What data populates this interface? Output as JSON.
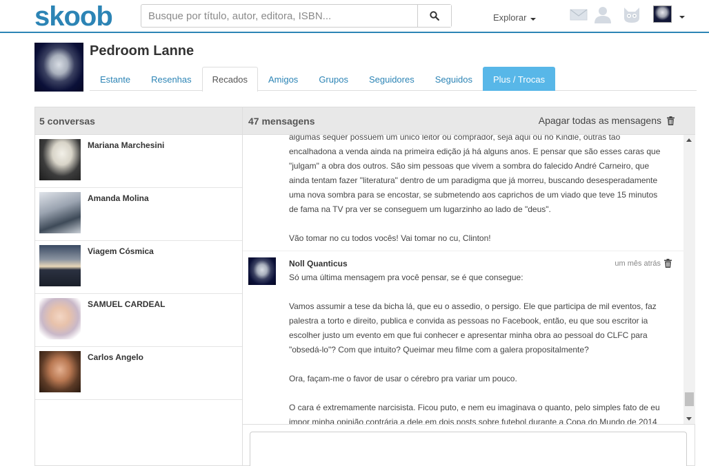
{
  "brand": {
    "logo": "skoob",
    "accent": "#2c84b5"
  },
  "search": {
    "placeholder": "Busque por título, autor, editora, ISBN...",
    "value": ""
  },
  "nav": {
    "explore_label": "Explorar"
  },
  "icons": [
    "envelope-icon",
    "user-icon",
    "cat-icon",
    "search-icon",
    "trash-icon"
  ],
  "profile": {
    "name": "Pedroom Lanne"
  },
  "tabs": [
    {
      "label": "Estante"
    },
    {
      "label": "Resenhas"
    },
    {
      "label": "Recados"
    },
    {
      "label": "Amigos"
    },
    {
      "label": "Grupos"
    },
    {
      "label": "Seguidores"
    },
    {
      "label": "Seguidos"
    },
    {
      "label": "Plus / Trocas"
    }
  ],
  "conversations": {
    "header": "5 conversas",
    "items": [
      {
        "name": "Mariana Marchesini"
      },
      {
        "name": "Amanda Molina"
      },
      {
        "name": "Viagem Cósmica"
      },
      {
        "name": "SAMUEL CARDEAL"
      },
      {
        "name": "Carlos Angelo"
      }
    ]
  },
  "messages": {
    "header": "47 mensagens",
    "clear_all": "Apagar todas as mensagens",
    "first_block": [
      "algumas sequer possuem um único leitor ou comprador, seja aqui ou no Kindle, outras tão",
      "encalhadona a venda ainda na primeira edição já há alguns anos. E pensar que são esses caras que",
      "\"julgam\" a obra dos outros. São sim pessoas que vivem a sombra do falecido André Carneiro, que",
      "ainda tentam fazer \"literatura\" dentro de um paradigma que já morreu, buscando desesperadamente",
      "uma nova sombra para se encostar, se submetendo aos caprichos de um viado que teve 15 minutos",
      "de fama na TV pra ver se conseguem um lugarzinho ao lado de \"deus\".",
      "",
      "Vão tomar no cu todos vocês! Vai tomar no cu, Clinton!"
    ],
    "second": {
      "author": "Noll Quanticus",
      "time": "um mês atrás",
      "lines": [
        "Só uma última mensagem pra você pensar, se é que consegue:",
        "",
        "Vamos assumir a tese da bicha lá, que eu o assedio, o persigo. Ele que participa de mil eventos, faz",
        "palestra a torto e direito, publica e convida as pessoas no Facebook, então, eu que sou escritor ia",
        "escolher justo um evento em que fui conhecer e apresentar minha obra ao pessoal do CLFC para",
        "\"obsedá-lo\"? Com que intuito? Queimar meu filme com a galera propositalmente?",
        "",
        "Ora, façam-me o favor de usar o cérebro pra variar um pouco.",
        "",
        "O cara é extremamente narcisista. Ficou puto, e nem eu imaginava o quanto, pelo simples fato de eu",
        "impor minha opinião contrária a dele em dois posts sobre futebol durante a Copa do Mundo de 2014"
      ]
    }
  },
  "reply": {
    "value": ""
  }
}
